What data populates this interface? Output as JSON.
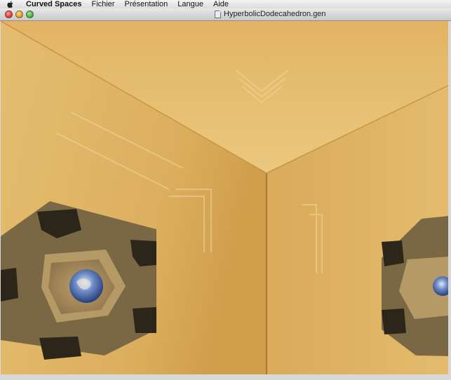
{
  "menubar": {
    "apple_icon": "apple-icon",
    "app_name": "Curved Spaces",
    "items": [
      "Fichier",
      "Présentation",
      "Langue",
      "Aide"
    ]
  },
  "window": {
    "title": "HyperbolicDodecahedron.gen",
    "traffic_lights": [
      {
        "name": "close-button",
        "color": "#e0443e"
      },
      {
        "name": "minimize-button",
        "color": "#dea123"
      },
      {
        "name": "zoom-button",
        "color": "#4fb23e"
      }
    ]
  },
  "colors": {
    "wood_light": "#e9c277",
    "wood_mid": "#d8a854",
    "wood_dark": "#b8863a",
    "hole_dark": "#3a3526",
    "earth_blue": "#3f5fa8"
  }
}
